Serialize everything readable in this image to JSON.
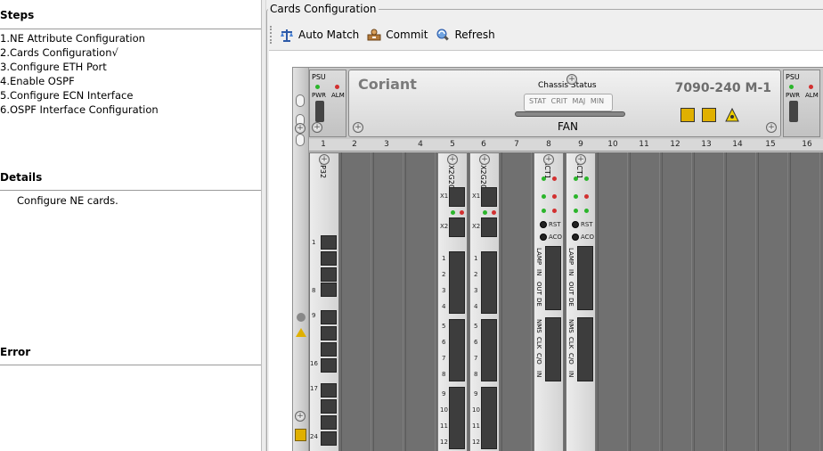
{
  "left": {
    "steps": {
      "title": "Steps",
      "items": [
        "1.NE Attribute Configuration",
        "2.Cards Configuration√",
        "3.Configure ETH Port",
        "4.Enable OSPF",
        "5.Configure ECN Interface",
        "6.OSPF Interface Configuration"
      ]
    },
    "details": {
      "title": "Details",
      "text": "Configure NE cards."
    },
    "error": {
      "title": "Error"
    }
  },
  "right": {
    "group_title": "Cards Configuration",
    "toolbar": {
      "auto_match": "Auto Match",
      "commit": "Commit",
      "refresh": "Refresh"
    }
  },
  "chassis": {
    "brand": "Coriant",
    "model": "7090-240 M-1",
    "status_title": "Chassis  Status",
    "status_leds": "STAT CRIT MAJ MIN",
    "fan_label": "FAN",
    "psu_label": "PSU",
    "pwr_label": "PWR",
    "alm_label": "ALM",
    "slot_numbers": [
      "1",
      "2",
      "3",
      "4",
      "5",
      "6",
      "7",
      "8",
      "9",
      "10",
      "11",
      "12",
      "13",
      "14",
      "15",
      "16"
    ],
    "cards": [
      {
        "slot": "1",
        "name": "1P32",
        "port_labels": [
          "1",
          "8",
          "9",
          "16",
          "17",
          "24"
        ]
      },
      {
        "slot": "5",
        "name": "SX2G20",
        "port_labels": [
          "X1",
          "X2",
          "1",
          "2",
          "3",
          "4",
          "5",
          "6",
          "7",
          "8",
          "9",
          "10",
          "11",
          "12"
        ]
      },
      {
        "slot": "6",
        "name": "SX2G20",
        "port_labels": [
          "X1",
          "X2",
          "1",
          "2",
          "3",
          "4",
          "5",
          "6",
          "7",
          "8",
          "9",
          "10",
          "11",
          "12"
        ]
      },
      {
        "slot": "8",
        "name": "ACT1",
        "text": [
          "RST",
          "ACO",
          "LAMP",
          "IN",
          "OUT",
          "DE",
          "NMS",
          "CLK",
          "C/O",
          "IN"
        ]
      },
      {
        "slot": "9",
        "name": "ACT1",
        "text": [
          "RST",
          "ACO",
          "LAMP",
          "IN",
          "OUT",
          "DE",
          "NMS",
          "CLK",
          "C/O",
          "IN"
        ]
      }
    ]
  }
}
